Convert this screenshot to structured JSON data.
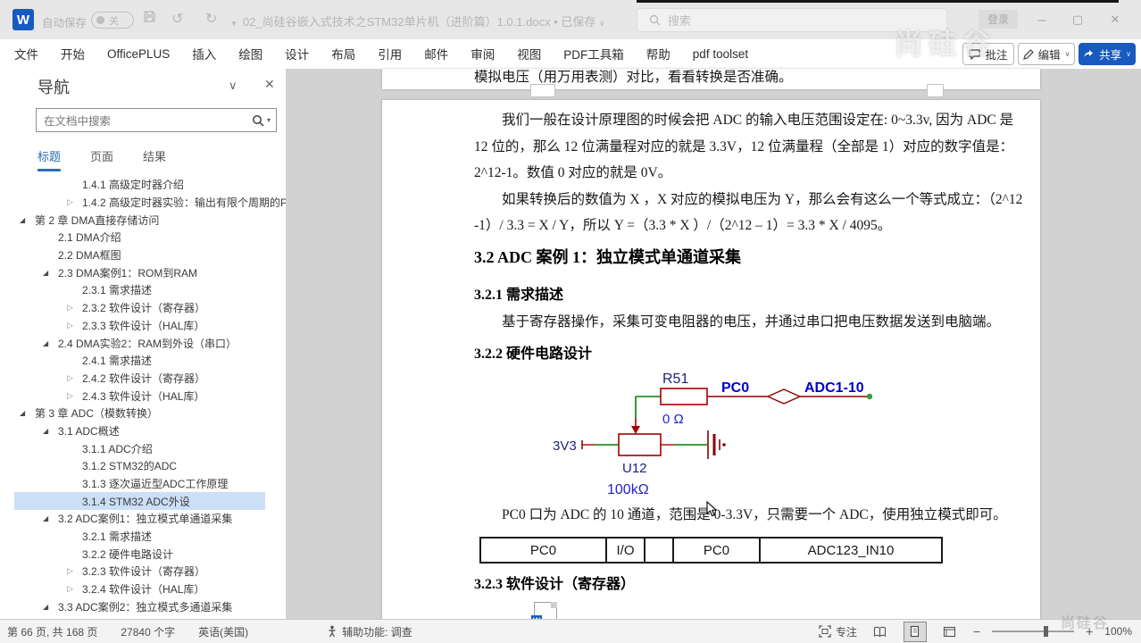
{
  "titlebar": {
    "autosave_label": "自动保存",
    "autosave_state": "关",
    "doc_title": "02_尚硅谷嵌入式技术之STM32单片机（进阶篇）1.0.1.docx",
    "save_status": "已保存",
    "search_placeholder": "搜索",
    "signin_label": "登录"
  },
  "ribbon": {
    "tabs": [
      "文件",
      "开始",
      "OfficePLUS",
      "插入",
      "绘图",
      "设计",
      "布局",
      "引用",
      "邮件",
      "审阅",
      "视图",
      "PDF工具箱",
      "帮助",
      "pdf toolset"
    ],
    "comments_label": "批注",
    "editing_label": "编辑",
    "share_label": "共享"
  },
  "watermark": "尚硅谷",
  "nav": {
    "title": "导航",
    "search_placeholder": "在文档中搜索",
    "tabs": [
      {
        "label": "标题",
        "active": true
      },
      {
        "label": "页面",
        "active": false
      },
      {
        "label": "结果",
        "active": false
      }
    ],
    "items": [
      {
        "label": "1.4.1 高级定时器介绍",
        "level": 3,
        "exp": "none"
      },
      {
        "label": "1.4.2 高级定时器实验：输出有限个周期的P...",
        "level": 3,
        "exp": "closed"
      },
      {
        "label": "第 2 章 DMA直接存储访问",
        "level": 1,
        "exp": "open"
      },
      {
        "label": "2.1 DMA介绍",
        "level": 2,
        "exp": "none"
      },
      {
        "label": "2.2 DMA框图",
        "level": 2,
        "exp": "none"
      },
      {
        "label": "2.3 DMA案例1：ROM到RAM",
        "level": 2,
        "exp": "open"
      },
      {
        "label": "2.3.1 需求描述",
        "level": 3,
        "exp": "none"
      },
      {
        "label": "2.3.2 软件设计（寄存器）",
        "level": 3,
        "exp": "closed"
      },
      {
        "label": "2.3.3 软件设计（HAL库）",
        "level": 3,
        "exp": "closed"
      },
      {
        "label": "2.4 DMA实验2：RAM到外设（串口）",
        "level": 2,
        "exp": "open"
      },
      {
        "label": "2.4.1 需求描述",
        "level": 3,
        "exp": "none"
      },
      {
        "label": "2.4.2 软件设计（寄存器）",
        "level": 3,
        "exp": "closed"
      },
      {
        "label": "2.4.3 软件设计（HAL库）",
        "level": 3,
        "exp": "closed"
      },
      {
        "label": "第 3 章 ADC（模数转换）",
        "level": 1,
        "exp": "open"
      },
      {
        "label": "3.1 ADC概述",
        "level": 2,
        "exp": "open"
      },
      {
        "label": "3.1.1 ADC介绍",
        "level": 3,
        "exp": "none"
      },
      {
        "label": "3.1.2 STM32的ADC",
        "level": 3,
        "exp": "none"
      },
      {
        "label": "3.1.3 逐次逼近型ADC工作原理",
        "level": 3,
        "exp": "none"
      },
      {
        "label": "3.1.4 STM32 ADC外设",
        "level": 3,
        "exp": "none",
        "selected": true
      },
      {
        "label": "3.2 ADC案例1：独立模式单通道采集",
        "level": 2,
        "exp": "open"
      },
      {
        "label": "3.2.1 需求描述",
        "level": 3,
        "exp": "none"
      },
      {
        "label": "3.2.2 硬件电路设计",
        "level": 3,
        "exp": "none"
      },
      {
        "label": "3.2.3 软件设计（寄存器）",
        "level": 3,
        "exp": "closed"
      },
      {
        "label": "3.2.4 软件设计（HAL库）",
        "level": 3,
        "exp": "closed"
      },
      {
        "label": "3.3 ADC案例2：独立模式多通道采集",
        "level": 2,
        "exp": "open"
      }
    ]
  },
  "document": {
    "page1_line": "模拟电压（用万用表测）对比，看看转换是否准确。",
    "para1": [
      "我们一般在设计原理图的时候会把 ADC 的输入电压范围设定在: 0~3.3v, 因为 ADC 是",
      "12 位的，那么 12 位满量程对应的就是 3.3V，12 位满量程（全部是 1）对应的数字值是：",
      "2^12-1。数值 0 对应的就是 0V。"
    ],
    "para2": [
      "如果转换后的数值为 X ，X 对应的模拟电压为 Y，那么会有这么一个等式成立：（2^12",
      "-1）/ 3.3 = X / Y，所以 Y =（3.3 * X ）/（2^12 – 1）= 3.3 * X / 4095。"
    ],
    "h2": "3.2 ADC 案例 1：独立模式单通道采集",
    "h3_1": "3.2.1 需求描述",
    "para3": "基于寄存器操作，采集可变电阻器的电压，并通过串口把电压数据发送到电脑端。",
    "h3_2": "3.2.2 硬件电路设计",
    "circuit": {
      "resistor_ref": "R51",
      "resistor_value": "0 Ω",
      "net_left": "PC0",
      "net_right": "ADC1-10",
      "supply": "3V3",
      "pot_ref": "U12",
      "pot_value": "100kΩ",
      "wire_color": "#008000",
      "component_color": "#a40000",
      "net_label_color": "#0000cc",
      "ref_label_color": "#1f1f7a"
    },
    "para4": "PC0 口为 ADC 的 10 通道，范围是 0-3.3V，只需要一个 ADC，使用独立模式即可。",
    "table": {
      "cells": [
        "PC0",
        "I/O",
        "",
        "PC0",
        "ADC123_IN10"
      ]
    },
    "h3_3": "3.2.3 软件设计（寄存器）"
  },
  "statusbar": {
    "page_info": "第 66 页, 共 168 页",
    "word_count": "27840 个字",
    "language": "英语(美国)",
    "accessibility": "辅助功能: 调查",
    "focus_label": "专注",
    "zoom_level": "100%"
  },
  "icons": {
    "word_logo": "W",
    "toggle_dot": "",
    "undo": "↺",
    "redo": "↻",
    "qat_chevron": "▼",
    "title_chevron": "∨",
    "minimize": "─",
    "maximize": "▢",
    "close": "✕",
    "nav_collapse": "∨",
    "nav_close": "✕",
    "search_dropdown": "▾",
    "tri_open": "◢",
    "tri_closed": "▷",
    "zoom_minus": "−",
    "zoom_plus": "+",
    "button_chevron": "∨"
  }
}
